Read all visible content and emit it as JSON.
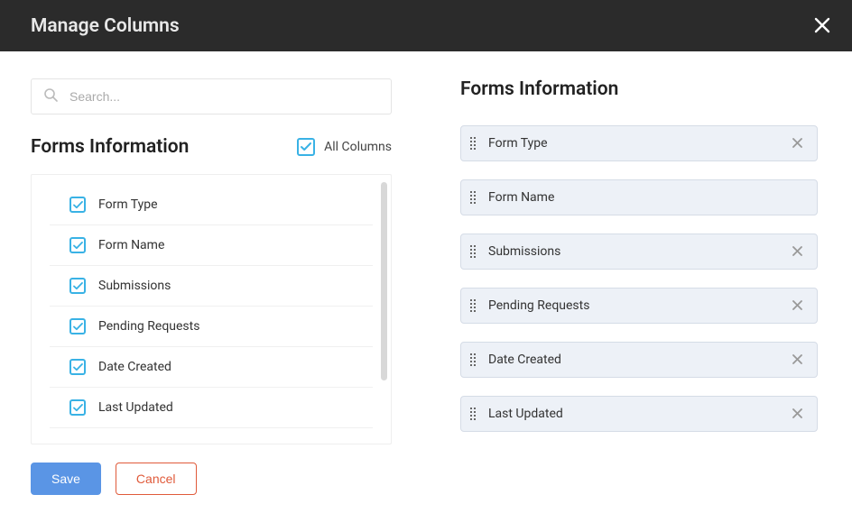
{
  "header": {
    "title": "Manage Columns"
  },
  "search": {
    "placeholder": "Search..."
  },
  "left": {
    "title": "Forms Information",
    "all_columns_label": "All Columns",
    "items": [
      {
        "label": "Form Type",
        "checked": true
      },
      {
        "label": "Form Name",
        "checked": true
      },
      {
        "label": "Submissions",
        "checked": true
      },
      {
        "label": "Pending Requests",
        "checked": true
      },
      {
        "label": "Date Created",
        "checked": true
      },
      {
        "label": "Last Updated",
        "checked": true
      }
    ]
  },
  "right": {
    "title": "Forms Information",
    "chips": [
      {
        "label": "Form Type",
        "removable": true
      },
      {
        "label": "Form Name",
        "removable": false
      },
      {
        "label": "Submissions",
        "removable": true
      },
      {
        "label": "Pending Requests",
        "removable": true
      },
      {
        "label": "Date Created",
        "removable": true
      },
      {
        "label": "Last Updated",
        "removable": true
      }
    ]
  },
  "buttons": {
    "save": "Save",
    "cancel": "Cancel"
  }
}
